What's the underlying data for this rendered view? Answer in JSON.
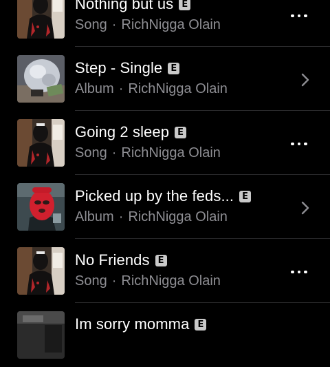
{
  "colors": {
    "background": "#000000",
    "title": "#ffffff",
    "subtitle": "#8e8e93",
    "explicit_badge": "#c9c9c9",
    "divider": "#2a2a2c"
  },
  "results": [
    {
      "title": "Nothing but us",
      "explicit_label": "E",
      "kind": "Song",
      "separator": "·",
      "artist": "RichNigga Olain",
      "artwork": "artist-photo-artwork",
      "action_icon": "more-icon"
    },
    {
      "title": "Step - Single",
      "explicit_label": "E",
      "kind": "Album",
      "separator": "·",
      "artist": "RichNigga Olain",
      "artwork": "money-bag-artwork",
      "action_icon": "chevron-right-icon"
    },
    {
      "title": "Going 2 sleep",
      "explicit_label": "E",
      "kind": "Song",
      "separator": "·",
      "artist": "RichNigga Olain",
      "artwork": "artist-photo-artwork",
      "action_icon": "more-icon"
    },
    {
      "title": "Picked up by the feds...",
      "explicit_label": "E",
      "kind": "Album",
      "separator": "·",
      "artist": "RichNigga Olain",
      "artwork": "red-ski-mask-artwork",
      "action_icon": "chevron-right-icon"
    },
    {
      "title": "No Friends",
      "explicit_label": "E",
      "kind": "Song",
      "separator": "·",
      "artist": "RichNigga Olain",
      "artwork": "artist-photo-artwork",
      "action_icon": "more-icon"
    },
    {
      "title": "Im sorry momma",
      "explicit_label": "E",
      "kind": "",
      "separator": "",
      "artist": "",
      "artwork": "dark-photo-artwork",
      "action_icon": ""
    }
  ]
}
